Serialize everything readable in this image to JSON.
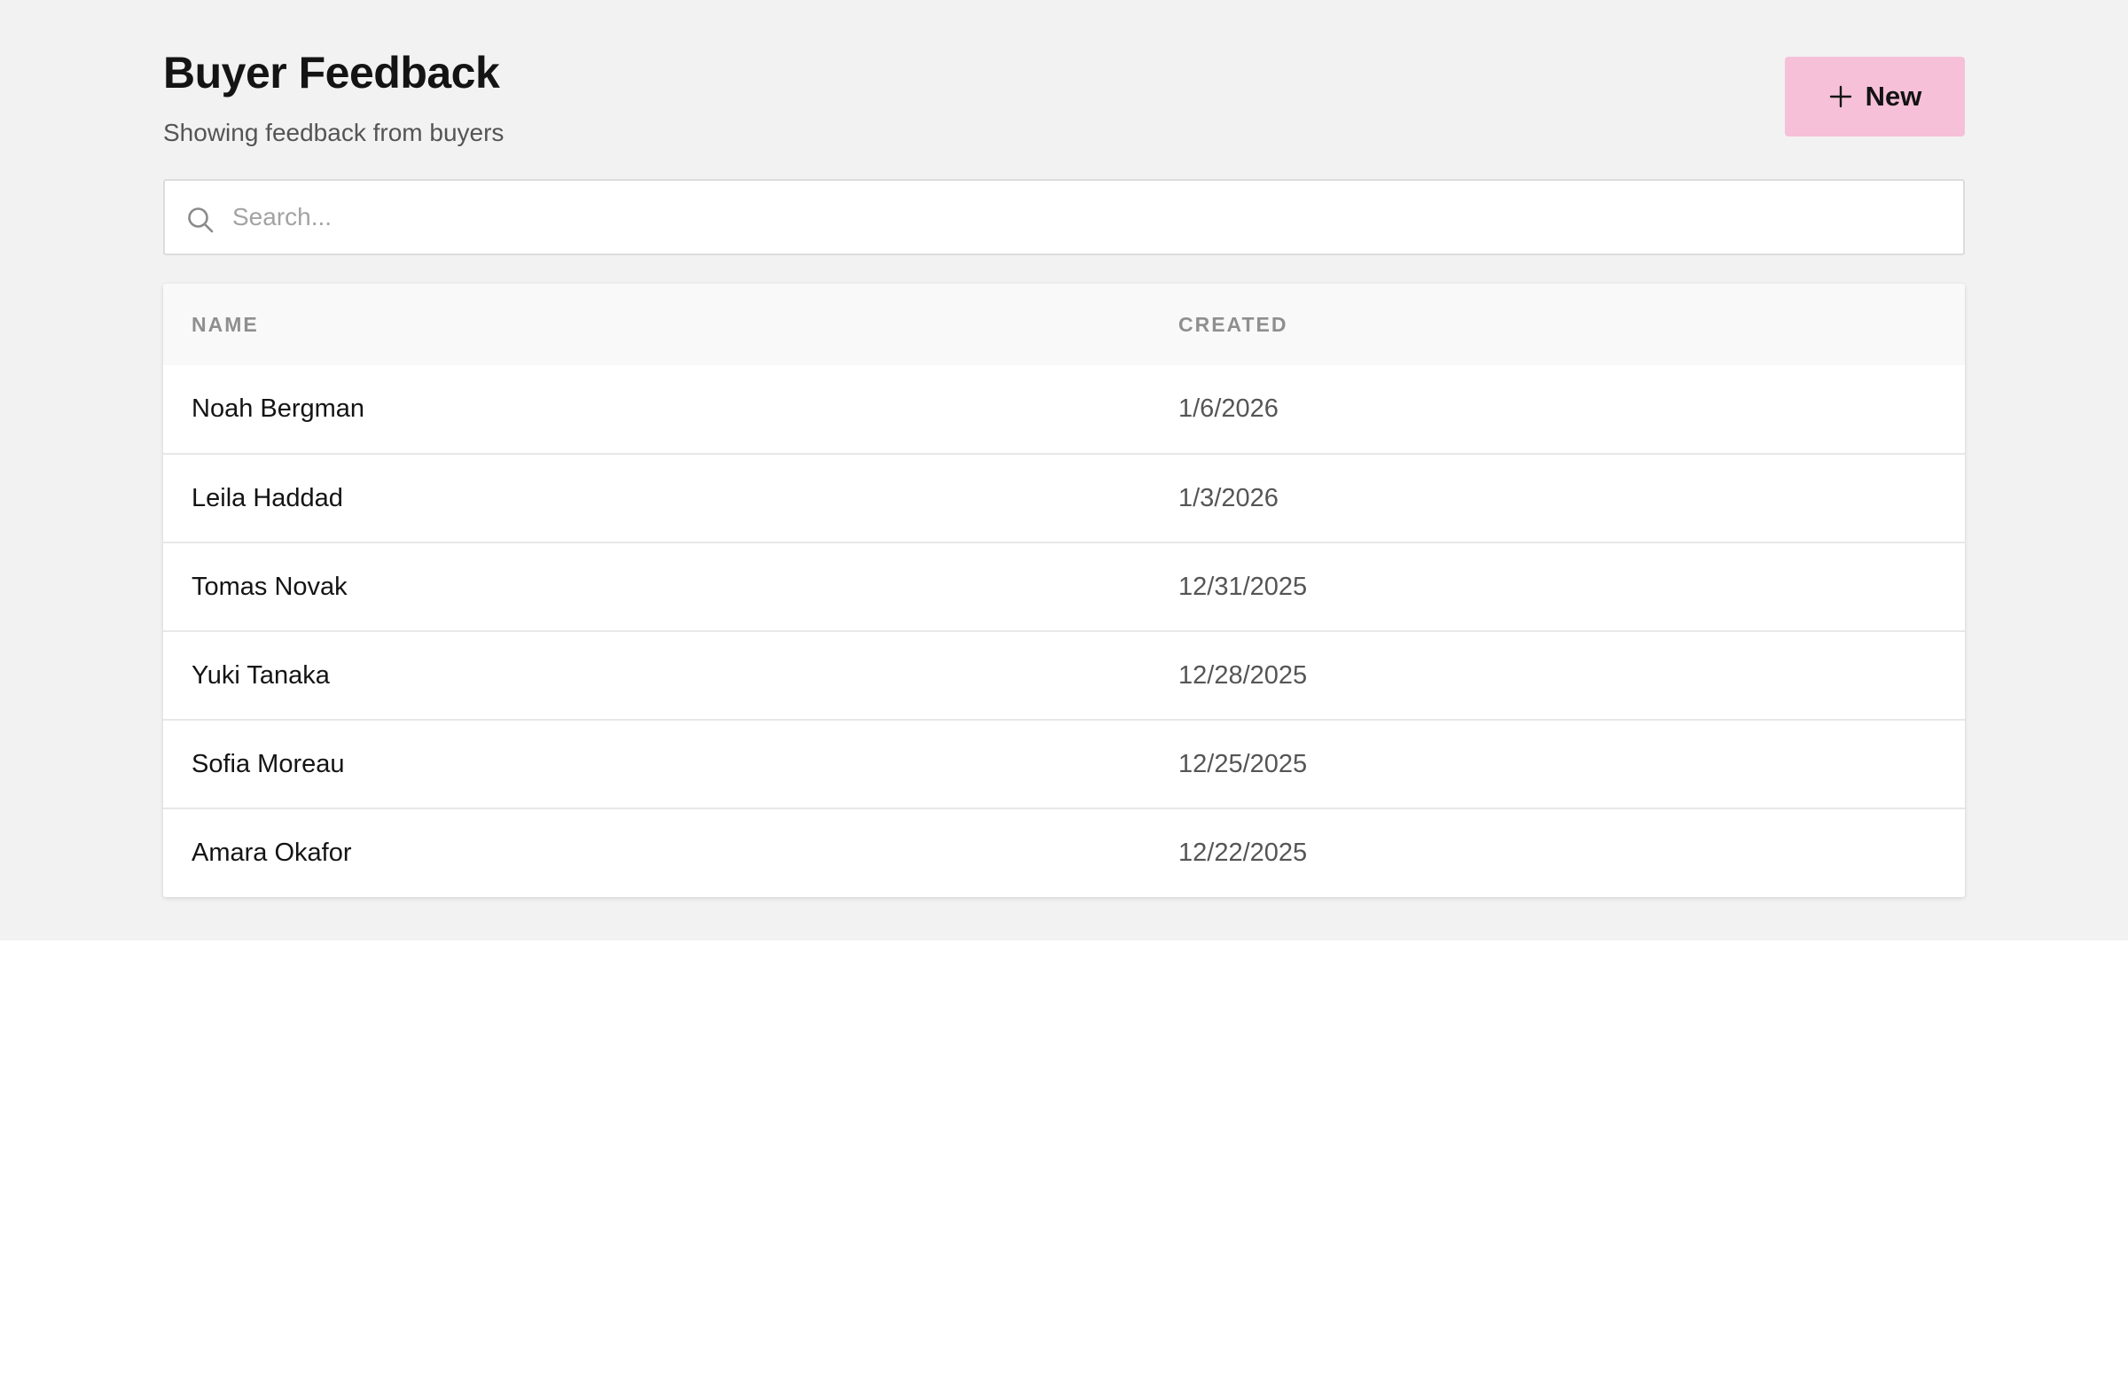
{
  "header": {
    "title": "Buyer Feedback",
    "subtitle": "Showing feedback from buyers",
    "new_button_label": "New",
    "new_button_icon": "plus-icon"
  },
  "search": {
    "placeholder": "Search...",
    "value": "",
    "icon": "search-icon"
  },
  "table": {
    "columns": [
      "NAME",
      "CREATED"
    ],
    "rows": [
      {
        "name": "Noah Bergman",
        "created": "1/6/2026"
      },
      {
        "name": "Leila Haddad",
        "created": "1/3/2026"
      },
      {
        "name": "Tomas Novak",
        "created": "12/31/2025"
      },
      {
        "name": "Yuki Tanaka",
        "created": "12/28/2025"
      },
      {
        "name": "Sofia Moreau",
        "created": "12/25/2025"
      },
      {
        "name": "Amara Okafor",
        "created": "12/22/2025"
      }
    ]
  },
  "colors": {
    "background": "#f2f2f2",
    "accent": "#f6c1d8",
    "text_primary": "#141414",
    "text_secondary": "#555555",
    "header_text": "#8f8f8f"
  }
}
